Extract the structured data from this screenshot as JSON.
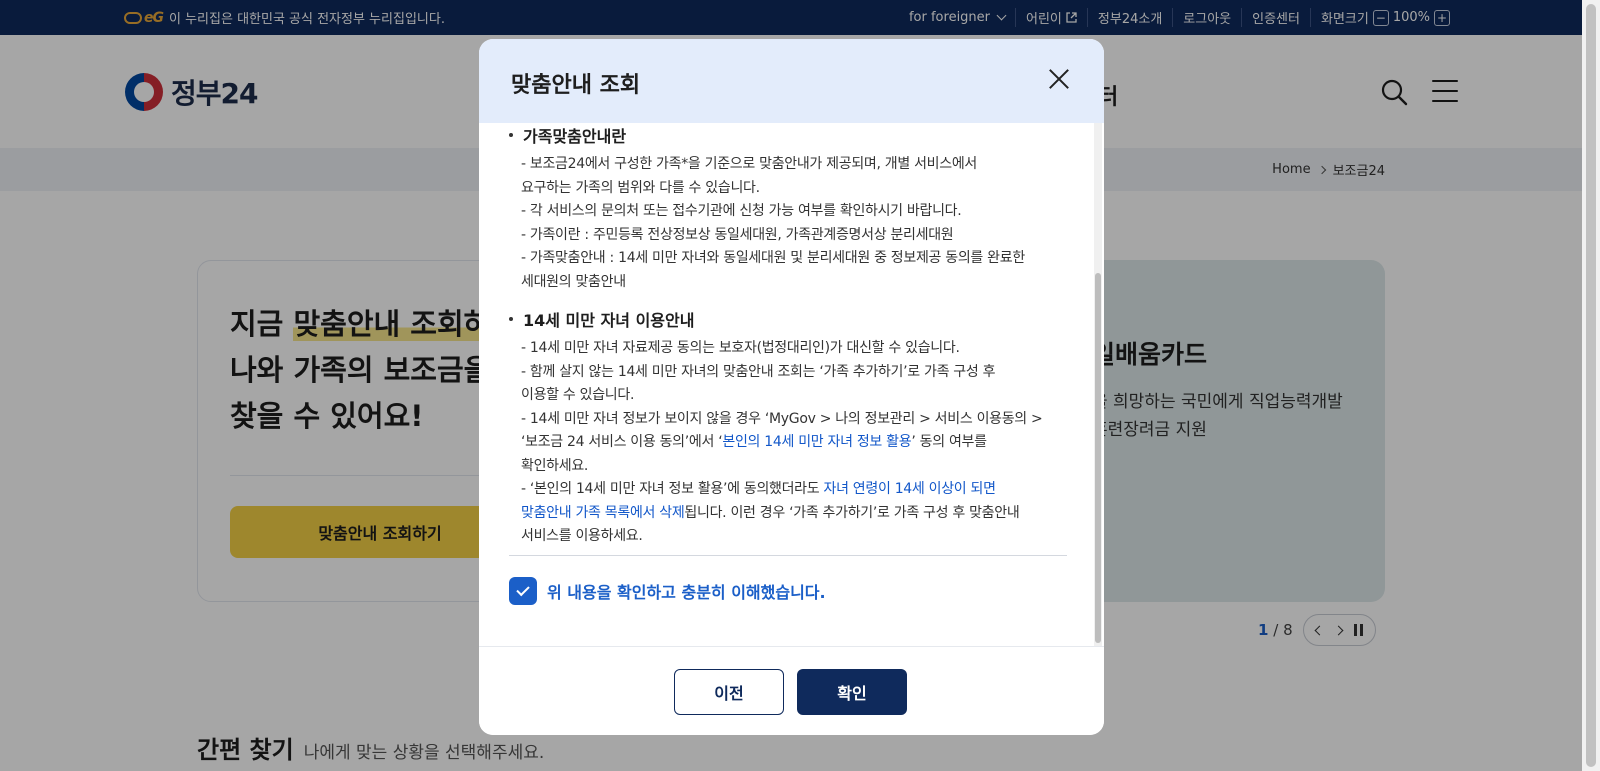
{
  "topbar": {
    "notice": "이 누리집은 대한민국 공식 전자정부 누리집입니다.",
    "logo_text": "eG",
    "foreigner": "for foreigner",
    "kids": "어린이",
    "about": "정부24소개",
    "logout": "로그아웃",
    "cert": "인증센터",
    "zoom_label": "화면크기",
    "zoom_minus": "−",
    "zoom_value": "100%",
    "zoom_plus": "+"
  },
  "header": {
    "brand": "정부24",
    "nav_fragment": "터"
  },
  "breadcrumb": {
    "home": "Home",
    "current": "보조금24"
  },
  "hero": {
    "line1_prefix": "지금 ",
    "line1_highlight": "맞춤안내 조회하",
    "line2": "나와 가족의 보조금을",
    "line3": "찾을 수 있어요!",
    "cta": "맞춤안내 조회하기"
  },
  "promo": {
    "title": "일배움카드",
    "desc_line1": "을 희망하는 국민에게 직업능력개발",
    "desc_line2": "훈련장려금 지원"
  },
  "pager": {
    "current": "1",
    "separator": "/",
    "total": "8"
  },
  "quick": {
    "title": "간편 찾기",
    "desc": "나에게 맞는 상황을 선택해주세요."
  },
  "modal": {
    "title": "맞춤안내 조회",
    "section1": {
      "title": "가족맞춤안내란",
      "lines": [
        "- 보조금24에서 구성한 가족*을 기준으로 맞춤안내가 제공되며, 개별 서비스에서",
        "요구하는 가족의 범위와 다를 수 있습니다.",
        "- 각 서비스의 문의처 또는 접수기관에 신청 가능 여부를 확인하시기 바랍니다.",
        "- 가족이란 : 주민등록 전상정보상 동일세대원, 가족관계증명서상 분리세대원",
        "- 가족맞춤안내 : 14세 미만 자녀와 동일세대원 및 분리세대원 중 정보제공 동의를 완료한",
        "세대원의 맞춤안내"
      ]
    },
    "section2": {
      "title": "14세 미만 자녀 이용안내",
      "line1": "- 14세 미만 자녀 자료제공 동의는 보호자(법정대리인)가 대신할 수 있습니다.",
      "line2": "- 함께 살지 않는 14세 미만 자녀의 맞춤안내 조회는 ‘가족 추가하기’로 가족 구성 후",
      "line3": "이용할 수 있습니다.",
      "line4": "- 14세 미만 자녀 정보가 보이지 않을 경우 ‘MyGov > 나의 정보관리 > 서비스 이용동의 >",
      "line5_prefix": "‘보조금 24 서비스 이용 동의’에서 ‘",
      "line5_link": "본인의 14세 미만 자녀 정보 활용",
      "line5_suffix": "’ 동의 여부를",
      "line6": "확인하세요.",
      "line7_prefix": "- ‘본인의 14세 미만 자녀 정보 활용’에 동의했더라도 ",
      "line7_blue": "자녀 연령이 14세 이상이 되면",
      "line8_blue": "맞춤안내 가족 목록에서 삭제",
      "line8_suffix": "됩니다. 이런 경우 ‘가족 추가하기’로 가족 구성 후 맞춤안내",
      "line9": "서비스를 이용하세요."
    },
    "agree_label": "위 내용을 확인하고 충분히 이해했습니다.",
    "agree_checked": true,
    "prev_button": "이전",
    "confirm_button": "확인"
  },
  "colors": {
    "topbar_bg": "#0f2a5c",
    "primary": "#0f2a5c",
    "link_blue": "#1257c9",
    "checkbox_blue": "#1b5fc8",
    "cta_yellow": "#f3cf45",
    "modal_head_bg": "#e3ecfb"
  }
}
